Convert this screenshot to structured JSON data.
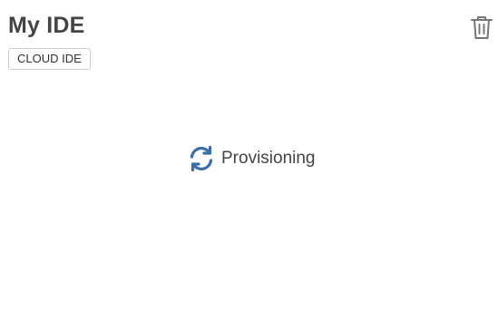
{
  "card": {
    "title": "My IDE",
    "badge_label": "CLOUD IDE",
    "delete_icon": "trash-icon"
  },
  "status": {
    "icon": "sync-icon",
    "label": "Provisioning",
    "icon_color": "#3a6fa8"
  },
  "colors": {
    "title_text": "#444444",
    "badge_border": "#cfcfcf",
    "trash_icon": "#777777"
  }
}
